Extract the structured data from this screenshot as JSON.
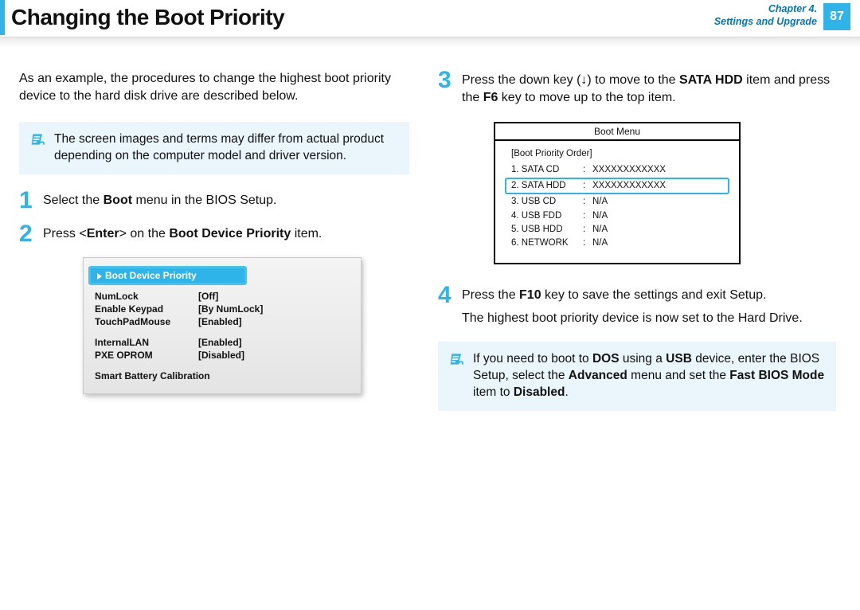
{
  "header": {
    "title": "Changing the Boot Priority",
    "chapter_line1": "Chapter 4.",
    "chapter_line2": "Settings and Upgrade",
    "page_number": "87"
  },
  "left": {
    "intro": "As an example, the procedures to change the highest boot priority device to the hard disk drive are described below.",
    "note": "The screen images and terms may differ from actual product depending on the computer model and driver version.",
    "step1_num": "1",
    "step1_pre": "Select the ",
    "step1_b": "Boot",
    "step1_post": " menu in the BIOS Setup.",
    "step2_num": "2",
    "step2_pre": "Press <",
    "step2_b1": "Enter",
    "step2_mid": "> on the ",
    "step2_b2": "Boot Device Priority",
    "step2_post": " item.",
    "bios": {
      "highlight": "Boot Device Priority",
      "rows": [
        {
          "k": "NumLock",
          "v": "[Off]"
        },
        {
          "k": "Enable Keypad",
          "v": "[By NumLock]"
        },
        {
          "k": "TouchPadMouse",
          "v": "[Enabled]"
        }
      ],
      "rows2": [
        {
          "k": "InternalLAN",
          "v": "[Enabled]"
        },
        {
          "k": "PXE OPROM",
          "v": "[Disabled]"
        }
      ],
      "footer": "Smart Battery Calibration"
    }
  },
  "right": {
    "step3_num": "3",
    "step3_pre": "Press the down key (↓) to move to the ",
    "step3_b1": "SATA HDD",
    "step3_mid": " item and press the ",
    "step3_b2": "F6",
    "step3_post": " key to move up to the top item.",
    "boot_menu": {
      "title": "Boot Menu",
      "section": "[Boot Priority Order]",
      "items": [
        {
          "n": "1. SATA CD",
          "d": "XXXXXXXXXXXX",
          "hl": false
        },
        {
          "n": "2. SATA HDD",
          "d": "XXXXXXXXXXXX",
          "hl": true
        },
        {
          "n": "3. USB CD",
          "d": "N/A",
          "hl": false
        },
        {
          "n": "4. USB FDD",
          "d": "N/A",
          "hl": false
        },
        {
          "n": "5. USB HDD",
          "d": "N/A",
          "hl": false
        },
        {
          "n": "6. NETWORK",
          "d": "N/A",
          "hl": false
        }
      ]
    },
    "step4_num": "4",
    "step4_pre": "Press the ",
    "step4_b1": "F10",
    "step4_mid": " key to save the settings and exit Setup.",
    "step4_line2": "The highest boot priority device is now set to the Hard Drive.",
    "note_pre": "If you need to boot to ",
    "note_b1": "DOS",
    "note_mid1": " using a ",
    "note_b2": "USB",
    "note_mid2": " device, enter the BIOS Setup, select the ",
    "note_b3": "Advanced",
    "note_mid3": " menu and set the ",
    "note_b4": "Fast BIOS Mode",
    "note_mid4": " item to ",
    "note_b5": "Disabled",
    "note_post": "."
  }
}
